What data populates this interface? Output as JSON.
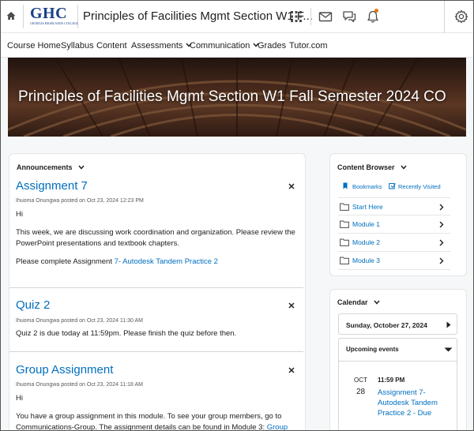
{
  "header": {
    "logo_main": "GHC",
    "logo_sub": "GEORGIA HIGHLANDS COLLEGE",
    "course_title": "Principles of Facilities Mgmt Section W1 F..."
  },
  "nav": {
    "items": [
      {
        "label": "Course Home"
      },
      {
        "label": "Syllabus"
      },
      {
        "label": "Content"
      },
      {
        "label": "Assessments"
      },
      {
        "label": "Communication"
      },
      {
        "label": "Grades"
      },
      {
        "label": "Tutor.com"
      }
    ]
  },
  "banner": {
    "title": "Principles of Facilities Mgmt Section W1 Fall Semester 2024 CO"
  },
  "announcements": {
    "heading": "Announcements",
    "items": [
      {
        "title": "Assignment 7",
        "meta": "Ihuoma Onungwa posted on Oct 23, 2024 12:23 PM",
        "p1": "Hi",
        "p2": "This week, we are discussing work coordination and organization. Please review the PowerPoint presentations and textbook chapters.",
        "p3_text": "Please complete Assignment ",
        "p3_link": "7- Autodesk Tandem Practice 2"
      },
      {
        "title": "Quiz 2",
        "meta": "Ihuoma Onungwa posted on Oct 23, 2024 11:30 AM",
        "p1": "Quiz 2 is due today at 11:59pm. Please finish the quiz before then."
      },
      {
        "title": "Group Assignment",
        "meta": "Ihuoma Onungwa posted on Oct 23, 2024 11:18 AM",
        "p1": "Hi",
        "p2_text": "You have a group assignment in this module. To see your group members, go to Communications-Group. The assignment details can be found in Module 3: ",
        "p2_link": "Group"
      }
    ]
  },
  "content_browser": {
    "heading": "Content Browser",
    "bookmarks": "Bookmarks",
    "recently_visited": "Recently Visited",
    "rows": [
      {
        "label": "Start Here"
      },
      {
        "label": "Module 1"
      },
      {
        "label": "Module 2"
      },
      {
        "label": "Module 3"
      }
    ]
  },
  "calendar": {
    "heading": "Calendar",
    "date": "Sunday, October 27, 2024",
    "upcoming_heading": "Upcoming events",
    "event": {
      "month": "OCT",
      "day": "28",
      "time": "11:59 PM",
      "title": "Assignment 7- Autodesk Tandem Practice 2 - Due"
    }
  }
}
